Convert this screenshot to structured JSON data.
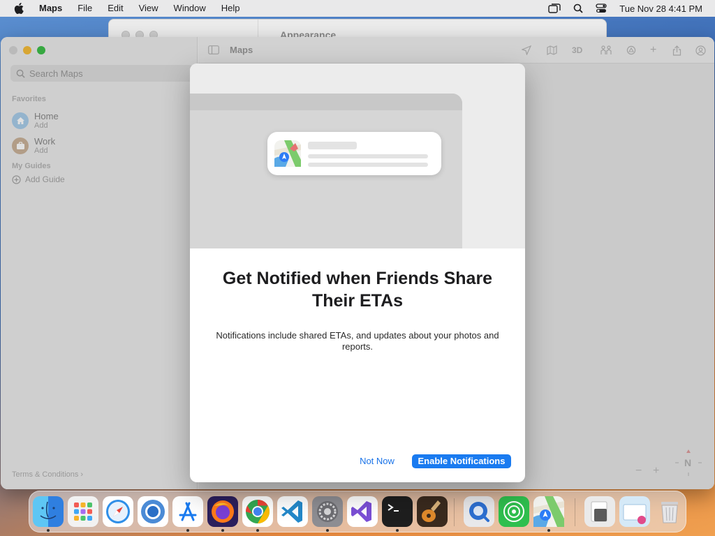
{
  "menubar": {
    "app_name": "Maps",
    "items": [
      "File",
      "Edit",
      "View",
      "Window",
      "Help"
    ],
    "clock": "Tue Nov 28  4:41 PM"
  },
  "background_window": {
    "title": "Appearance"
  },
  "maps_window": {
    "title": "Maps",
    "search_placeholder": "Search Maps",
    "favorites_label": "Favorites",
    "favorites": [
      {
        "name": "Home",
        "sub": "Add"
      },
      {
        "name": "Work",
        "sub": "Add"
      }
    ],
    "my_guides_label": "My Guides",
    "add_guide_label": "Add Guide",
    "terms_label": "Terms & Conditions",
    "toolbar": {
      "three_d": "3D"
    },
    "zoom_out": "−",
    "zoom_in": "+",
    "compass_label": "N"
  },
  "modal": {
    "title": "Get Notified when Friends Share Their ETAs",
    "description": "Notifications include shared ETAs, and updates about your photos and reports.",
    "secondary_button": "Not Now",
    "primary_button": "Enable Notifications"
  },
  "dock": {
    "apps": [
      "finder",
      "launchpad",
      "safari",
      "chromium",
      "app-store",
      "firefox",
      "chrome",
      "vscode",
      "system-settings",
      "visual-studio",
      "terminal",
      "garageband",
      "quicktime",
      "find-my",
      "maps",
      "preview",
      "mail",
      "trash"
    ]
  },
  "colors": {
    "accent": "#1a7bf0",
    "link": "#1a73e8",
    "home_badge": "#5aa9e6",
    "work_badge": "#b98a5a"
  }
}
